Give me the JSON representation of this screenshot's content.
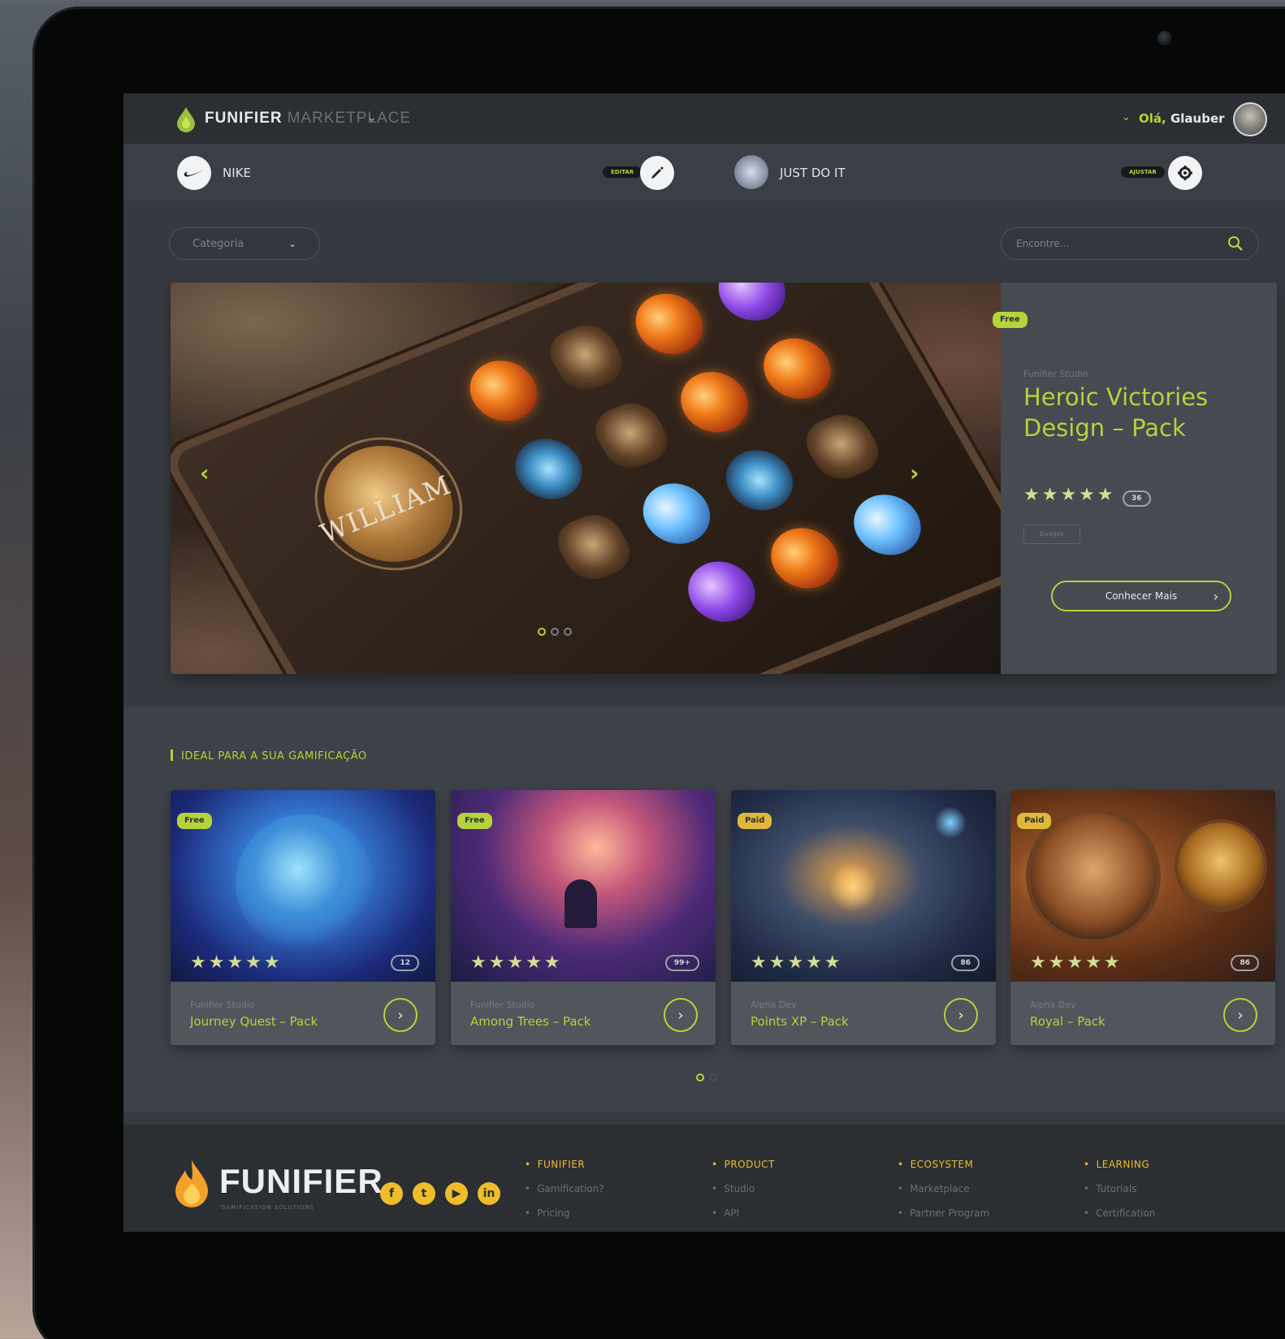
{
  "header": {
    "brand": "FUNIFIER",
    "brand_sub": "MARKETPLACE",
    "greeting_prefix": "Olá,",
    "greeting_name": "Glauber"
  },
  "company_bar": {
    "company_name": "NIKE",
    "edit_tag": "EDITAR",
    "team_name": "JUST DO IT",
    "settings_tag": "AJUSTAR"
  },
  "filters": {
    "category_label": "Categoria",
    "search_placeholder": "Encontre..."
  },
  "hero": {
    "badge": "Free",
    "author": "Funifier Studio",
    "title": "Heroic Victories Design – Pack",
    "rating": 5,
    "stars": "★★★★★",
    "reviews": "36",
    "tag": "Badges",
    "cta": "Conhecer Mais",
    "art_title": "WILLIAM",
    "slides": 3,
    "active_slide": 1
  },
  "section": {
    "title": "IDEAL PARA A SUA GAMIFICAÇÃO"
  },
  "cards": [
    {
      "badge": "Free",
      "badge_type": "free",
      "stars": "★★★★★",
      "count": "12",
      "author": "Funifier Studio",
      "title": "Journey Quest – Pack"
    },
    {
      "badge": "Free",
      "badge_type": "free",
      "stars": "★★★★★",
      "count": "99+",
      "author": "Funifier Studio",
      "title": "Among Trees – Pack"
    },
    {
      "badge": "Paid",
      "badge_type": "paid",
      "stars": "★★★★★",
      "count": "86",
      "author": "Alpha Dev",
      "title": "Points XP – Pack"
    },
    {
      "badge": "Paid",
      "badge_type": "paid",
      "stars": "★★★★★",
      "count": "86",
      "author": "Alpha Dev",
      "title": "Royal – Pack"
    }
  ],
  "footer": {
    "brand": "FUNIFIER",
    "tagline": "GAMIFICATION SOLUTIONS",
    "social": [
      "f",
      "t",
      "▶",
      "in"
    ],
    "columns": [
      {
        "head": "FUNIFIER",
        "items": [
          "Gamification?",
          "Pricing"
        ]
      },
      {
        "head": "PRODUCT",
        "items": [
          "Studio",
          "API"
        ]
      },
      {
        "head": "ECOSYSTEM",
        "items": [
          "Marketplace",
          "Partner Program"
        ]
      },
      {
        "head": "LEARNING",
        "items": [
          "Tutorials",
          "Certification"
        ]
      }
    ]
  },
  "colors": {
    "accent_green": "#b5d33b",
    "accent_yellow": "#f0bc2a",
    "background": "#363a40"
  }
}
